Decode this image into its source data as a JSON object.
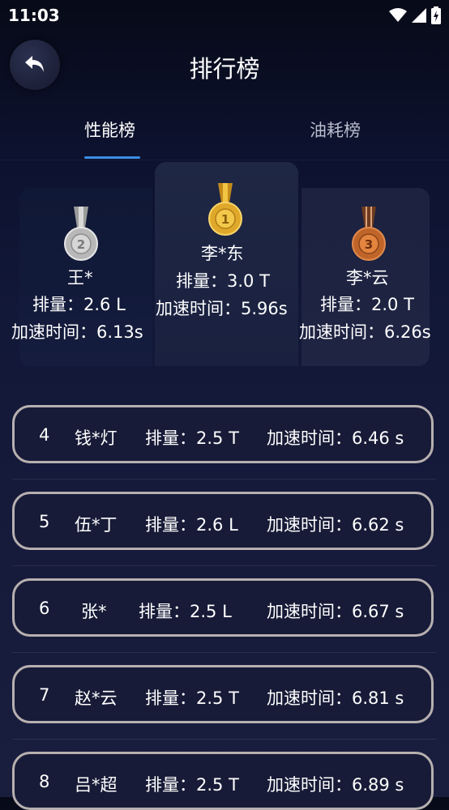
{
  "status": {
    "time": "11:03"
  },
  "header": {
    "title": "排行榜"
  },
  "tabs": [
    {
      "label": "性能榜"
    },
    {
      "label": "油耗榜"
    }
  ],
  "podium": [
    {
      "rank": "2",
      "medal": "silver-medal-icon",
      "name": "王*",
      "displacement": "排量：2.6 L",
      "accel": "加速时间：6.13s"
    },
    {
      "rank": "1",
      "medal": "gold-medal-icon",
      "name": "李*东",
      "displacement": "排量：3.0 T",
      "accel": "加速时间：5.96s"
    },
    {
      "rank": "3",
      "medal": "bronze-medal-icon",
      "name": "李*云",
      "displacement": "排量：2.0 T",
      "accel": "加速时间：6.26s"
    }
  ],
  "list": [
    {
      "rank": "4",
      "name": "钱*灯",
      "displacement": "排量：2.5 T",
      "accel": "加速时间：6.46 s"
    },
    {
      "rank": "5",
      "name": "伍*丁",
      "displacement": "排量：2.6 L",
      "accel": "加速时间：6.62 s"
    },
    {
      "rank": "6",
      "name": "张*",
      "displacement": "排量：2.5 L",
      "accel": "加速时间：6.67 s"
    },
    {
      "rank": "7",
      "name": "赵*云",
      "displacement": "排量：2.5 T",
      "accel": "加速时间：6.81 s"
    },
    {
      "rank": "8",
      "name": "吕*超",
      "displacement": "排量：2.5 T",
      "accel": "加速时间：6.89 s"
    }
  ],
  "colors": {
    "accent": "#3a8ee6",
    "gold": "#d9a521",
    "silver": "#b8b8b8",
    "bronze": "#c0652a"
  }
}
